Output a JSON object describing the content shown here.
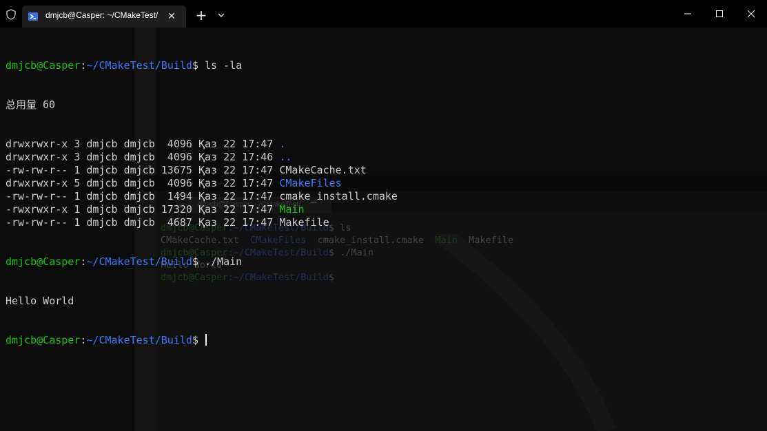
{
  "window": {
    "tab_title": "dmjcb@Casper: ~/CMakeTest/",
    "tab_close_icon": "close-icon",
    "new_tab_symbol": "+",
    "icons": [
      "shield-icon",
      "powershell-icon",
      "chevron-down-icon",
      "minimize-icon",
      "maximize-icon",
      "close-icon"
    ]
  },
  "terminal": {
    "prompt_user": "dmjcb@Casper",
    "prompt_colon": ":",
    "prompt_path": "~/CMakeTest/Build",
    "prompt_dollar": "$",
    "cmd1": " ls -la",
    "total": "总用量 60",
    "listing": [
      {
        "meta": "drwxrwxr-x 3 dmjcb dmjcb  4096 Қаз 22 17:47 ",
        "name": ".",
        "kind": "dir"
      },
      {
        "meta": "drwxrwxr-x 3 dmjcb dmjcb  4096 Қаз 22 17:46 ",
        "name": "..",
        "kind": "dir"
      },
      {
        "meta": "-rw-rw-r-- 1 dmjcb dmjcb 13675 Қаз 22 17:47 ",
        "name": "CMakeCache.txt",
        "kind": "file"
      },
      {
        "meta": "drwxrwxr-x 5 dmjcb dmjcb  4096 Қаз 22 17:47 ",
        "name": "CMakeFiles",
        "kind": "dir"
      },
      {
        "meta": "-rw-rw-r-- 1 dmjcb dmjcb  1494 Қаз 22 17:47 ",
        "name": "cmake_install.cmake",
        "kind": "file"
      },
      {
        "meta": "-rwxrwxr-x 1 dmjcb dmjcb 17320 Қаз 22 17:47 ",
        "name": "Main",
        "kind": "exec"
      },
      {
        "meta": "-rw-rw-r-- 1 dmjcb dmjcb  4687 Қаз 22 17:47 ",
        "name": "Makefile",
        "kind": "file"
      }
    ],
    "cmd2": " ./Main",
    "output": "Hello World"
  },
  "ghost": {
    "tab_title": "dmjcb@Casper: ~/CMakeTest/",
    "user": "dmjcb@Casper",
    "path": ":~/CMakeTest/Build",
    "cmd1": "$ ls",
    "files": [
      "CMakeCache.txt",
      "CMakeFiles",
      "cmake_install.cmake",
      "Main",
      "Makefile"
    ],
    "cmd2": "$ ./Main",
    "output": "Hello World",
    "dollar": "$"
  },
  "colors": {
    "prompt_user": "#16c60c",
    "prompt_path": "#3b78ff",
    "text": "#cccccc",
    "background": "#0c0c0c"
  }
}
